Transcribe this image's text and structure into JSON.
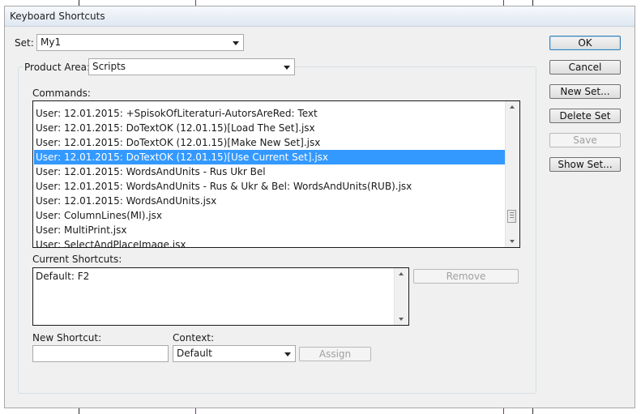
{
  "dialog": {
    "title": "Keyboard Shortcuts"
  },
  "set": {
    "label": "Set:",
    "value": "My1"
  },
  "product_area": {
    "label": "Product Area:",
    "value": "Scripts"
  },
  "commands": {
    "label": "Commands:",
    "items": [
      "User: 12.01.2015: +SpisokOfLiteraturi-AutorsAreRed: Text",
      "User: 12.01.2015: DoTextOK (12.01.15)[Load The Set].jsx",
      "User: 12.01.2015: DoTextOK (12.01.15)[Make New Set].jsx",
      "User: 12.01.2015: DoTextOK (12.01.15)[Use Current Set].jsx",
      "User: 12.01.2015: WordsAndUnits - Rus  Ukr  Bel",
      "User: 12.01.2015: WordsAndUnits - Rus & Ukr & Bel: WordsAndUnits(RUB).jsx",
      "User: 12.01.2015: WordsAndUnits.jsx",
      "User: ColumnLines(MI).jsx",
      "User: MultiPrint.jsx",
      "User: SelectAndPlaceImage.jsx"
    ],
    "selected_index": 3
  },
  "current_shortcuts": {
    "label": "Current Shortcuts:",
    "items": [
      "Default: F2"
    ]
  },
  "remove_label": "Remove",
  "new_shortcut": {
    "label": "New Shortcut:",
    "value": ""
  },
  "context": {
    "label": "Context:",
    "value": "Default"
  },
  "assign_label": "Assign",
  "buttons": {
    "ok": "OK",
    "cancel": "Cancel",
    "new_set": "New Set...",
    "delete_set": "Delete Set",
    "save": "Save",
    "show_set": "Show Set..."
  }
}
